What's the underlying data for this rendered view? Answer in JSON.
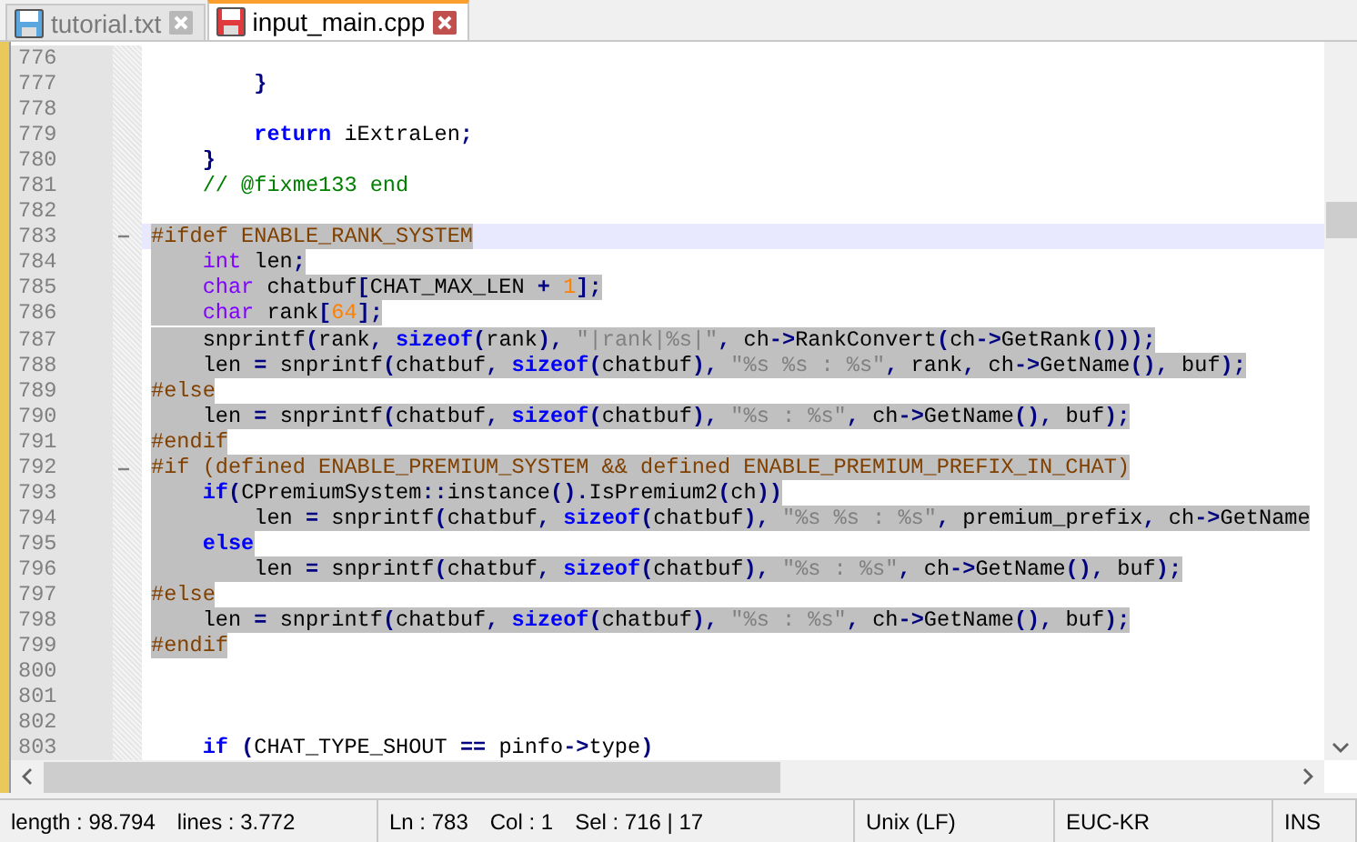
{
  "tabs": [
    {
      "label": "tutorial.txt",
      "selected": false
    },
    {
      "label": "input_main.cpp",
      "selected": true
    }
  ],
  "lines": [
    {
      "number": "776",
      "selected": false,
      "current": false,
      "foldable": false
    },
    {
      "number": "777",
      "selected": false,
      "current": false,
      "foldable": false,
      "tokens": [
        {
          "kind": "op",
          "text": "        }"
        }
      ]
    },
    {
      "number": "778",
      "selected": false,
      "current": false,
      "foldable": false
    },
    {
      "number": "779",
      "selected": false,
      "current": false,
      "foldable": false,
      "tokens": [
        {
          "kind": "keyword",
          "text": "        return"
        },
        {
          "kind": "plain",
          "text": " iExtraLen"
        },
        {
          "kind": "op",
          "text": ";"
        }
      ]
    },
    {
      "number": "780",
      "selected": false,
      "current": false,
      "foldable": false,
      "tokens": [
        {
          "kind": "op",
          "text": "    }"
        }
      ]
    },
    {
      "number": "781",
      "selected": false,
      "current": false,
      "foldable": false,
      "tokens": [
        {
          "kind": "comment",
          "text": "    // @fixme133 end"
        }
      ]
    },
    {
      "number": "782",
      "selected": false,
      "current": false,
      "foldable": false
    },
    {
      "number": "783",
      "selected": true,
      "current": true,
      "foldable": true,
      "tokens": [
        {
          "kind": "preprocessor",
          "text": "#ifdef ENABLE_RANK_SYSTEM"
        }
      ]
    },
    {
      "number": "784",
      "selected": true,
      "current": false,
      "foldable": false,
      "tokens": [
        {
          "kind": "type",
          "text": "    int"
        },
        {
          "kind": "plain",
          "text": " len"
        },
        {
          "kind": "op",
          "text": ";"
        }
      ]
    },
    {
      "number": "785",
      "selected": true,
      "current": false,
      "foldable": false,
      "tokens": [
        {
          "kind": "type",
          "text": "    char"
        },
        {
          "kind": "plain",
          "text": " chatbuf"
        },
        {
          "kind": "op",
          "text": "["
        },
        {
          "kind": "plain",
          "text": "CHAT_MAX_LEN "
        },
        {
          "kind": "op",
          "text": "+ "
        },
        {
          "kind": "number",
          "text": "1"
        },
        {
          "kind": "op",
          "text": "];"
        }
      ]
    },
    {
      "number": "786",
      "selected": true,
      "current": false,
      "foldable": false,
      "tokens": [
        {
          "kind": "type",
          "text": "    char"
        },
        {
          "kind": "plain",
          "text": " rank"
        },
        {
          "kind": "op",
          "text": "["
        },
        {
          "kind": "number",
          "text": "64"
        },
        {
          "kind": "op",
          "text": "];"
        }
      ]
    },
    {
      "number": "787",
      "selected": true,
      "current": false,
      "foldable": false,
      "tokens": [
        {
          "kind": "plain",
          "text": "    snprintf"
        },
        {
          "kind": "op",
          "text": "("
        },
        {
          "kind": "plain",
          "text": "rank"
        },
        {
          "kind": "op",
          "text": ", "
        },
        {
          "kind": "keyword",
          "text": "sizeof"
        },
        {
          "kind": "op",
          "text": "("
        },
        {
          "kind": "plain",
          "text": "rank"
        },
        {
          "kind": "op",
          "text": "), "
        },
        {
          "kind": "string",
          "text": "\"|rank|%s|\""
        },
        {
          "kind": "op",
          "text": ", "
        },
        {
          "kind": "plain",
          "text": "ch"
        },
        {
          "kind": "op",
          "text": "->"
        },
        {
          "kind": "plain",
          "text": "RankConvert"
        },
        {
          "kind": "op",
          "text": "("
        },
        {
          "kind": "plain",
          "text": "ch"
        },
        {
          "kind": "op",
          "text": "->"
        },
        {
          "kind": "plain",
          "text": "GetRank"
        },
        {
          "kind": "op",
          "text": "()));"
        }
      ]
    },
    {
      "number": "788",
      "selected": true,
      "current": false,
      "foldable": false,
      "tokens": [
        {
          "kind": "plain",
          "text": "    len "
        },
        {
          "kind": "op",
          "text": "="
        },
        {
          "kind": "plain",
          "text": " snprintf"
        },
        {
          "kind": "op",
          "text": "("
        },
        {
          "kind": "plain",
          "text": "chatbuf"
        },
        {
          "kind": "op",
          "text": ", "
        },
        {
          "kind": "keyword",
          "text": "sizeof"
        },
        {
          "kind": "op",
          "text": "("
        },
        {
          "kind": "plain",
          "text": "chatbuf"
        },
        {
          "kind": "op",
          "text": "), "
        },
        {
          "kind": "string",
          "text": "\"%s %s : %s\""
        },
        {
          "kind": "op",
          "text": ", "
        },
        {
          "kind": "plain",
          "text": "rank"
        },
        {
          "kind": "op",
          "text": ", "
        },
        {
          "kind": "plain",
          "text": "ch"
        },
        {
          "kind": "op",
          "text": "->"
        },
        {
          "kind": "plain",
          "text": "GetName"
        },
        {
          "kind": "op",
          "text": "(), "
        },
        {
          "kind": "plain",
          "text": "buf"
        },
        {
          "kind": "op",
          "text": ");"
        }
      ]
    },
    {
      "number": "789",
      "selected": true,
      "current": false,
      "foldable": false,
      "tokens": [
        {
          "kind": "preprocessor",
          "text": "#else"
        }
      ]
    },
    {
      "number": "790",
      "selected": true,
      "current": false,
      "foldable": false,
      "tokens": [
        {
          "kind": "plain",
          "text": "    len "
        },
        {
          "kind": "op",
          "text": "="
        },
        {
          "kind": "plain",
          "text": " snprintf"
        },
        {
          "kind": "op",
          "text": "("
        },
        {
          "kind": "plain",
          "text": "chatbuf"
        },
        {
          "kind": "op",
          "text": ", "
        },
        {
          "kind": "keyword",
          "text": "sizeof"
        },
        {
          "kind": "op",
          "text": "("
        },
        {
          "kind": "plain",
          "text": "chatbuf"
        },
        {
          "kind": "op",
          "text": "), "
        },
        {
          "kind": "string",
          "text": "\"%s : %s\""
        },
        {
          "kind": "op",
          "text": ", "
        },
        {
          "kind": "plain",
          "text": "ch"
        },
        {
          "kind": "op",
          "text": "->"
        },
        {
          "kind": "plain",
          "text": "GetName"
        },
        {
          "kind": "op",
          "text": "(), "
        },
        {
          "kind": "plain",
          "text": "buf"
        },
        {
          "kind": "op",
          "text": ");"
        }
      ]
    },
    {
      "number": "791",
      "selected": true,
      "current": false,
      "foldable": false,
      "tokens": [
        {
          "kind": "preprocessor",
          "text": "#endif"
        }
      ]
    },
    {
      "number": "792",
      "selected": true,
      "current": false,
      "foldable": true,
      "tokens": [
        {
          "kind": "preprocessor",
          "text": "#if (defined ENABLE_PREMIUM_SYSTEM && defined ENABLE_PREMIUM_PREFIX_IN_CHAT)"
        }
      ]
    },
    {
      "number": "793",
      "selected": true,
      "current": false,
      "foldable": false,
      "tokens": [
        {
          "kind": "keyword",
          "text": "    if"
        },
        {
          "kind": "op",
          "text": "("
        },
        {
          "kind": "plain",
          "text": "CPremiumSystem"
        },
        {
          "kind": "op",
          "text": "::"
        },
        {
          "kind": "plain",
          "text": "instance"
        },
        {
          "kind": "op",
          "text": "()."
        },
        {
          "kind": "plain",
          "text": "IsPremium2"
        },
        {
          "kind": "op",
          "text": "("
        },
        {
          "kind": "plain",
          "text": "ch"
        },
        {
          "kind": "op",
          "text": "))"
        }
      ]
    },
    {
      "number": "794",
      "selected": true,
      "current": false,
      "foldable": false,
      "tokens": [
        {
          "kind": "plain",
          "text": "        len "
        },
        {
          "kind": "op",
          "text": "="
        },
        {
          "kind": "plain",
          "text": " snprintf"
        },
        {
          "kind": "op",
          "text": "("
        },
        {
          "kind": "plain",
          "text": "chatbuf"
        },
        {
          "kind": "op",
          "text": ", "
        },
        {
          "kind": "keyword",
          "text": "sizeof"
        },
        {
          "kind": "op",
          "text": "("
        },
        {
          "kind": "plain",
          "text": "chatbuf"
        },
        {
          "kind": "op",
          "text": "), "
        },
        {
          "kind": "string",
          "text": "\"%s %s : %s\""
        },
        {
          "kind": "op",
          "text": ", "
        },
        {
          "kind": "plain",
          "text": "premium_prefix"
        },
        {
          "kind": "op",
          "text": ", "
        },
        {
          "kind": "plain",
          "text": "ch"
        },
        {
          "kind": "op",
          "text": "->"
        },
        {
          "kind": "plain",
          "text": "GetName"
        }
      ]
    },
    {
      "number": "795",
      "selected": true,
      "current": false,
      "foldable": false,
      "tokens": [
        {
          "kind": "keyword",
          "text": "    else"
        }
      ]
    },
    {
      "number": "796",
      "selected": true,
      "current": false,
      "foldable": false,
      "tokens": [
        {
          "kind": "plain",
          "text": "        len "
        },
        {
          "kind": "op",
          "text": "="
        },
        {
          "kind": "plain",
          "text": " snprintf"
        },
        {
          "kind": "op",
          "text": "("
        },
        {
          "kind": "plain",
          "text": "chatbuf"
        },
        {
          "kind": "op",
          "text": ", "
        },
        {
          "kind": "keyword",
          "text": "sizeof"
        },
        {
          "kind": "op",
          "text": "("
        },
        {
          "kind": "plain",
          "text": "chatbuf"
        },
        {
          "kind": "op",
          "text": "), "
        },
        {
          "kind": "string",
          "text": "\"%s : %s\""
        },
        {
          "kind": "op",
          "text": ", "
        },
        {
          "kind": "plain",
          "text": "ch"
        },
        {
          "kind": "op",
          "text": "->"
        },
        {
          "kind": "plain",
          "text": "GetName"
        },
        {
          "kind": "op",
          "text": "(), "
        },
        {
          "kind": "plain",
          "text": "buf"
        },
        {
          "kind": "op",
          "text": ");"
        }
      ]
    },
    {
      "number": "797",
      "selected": true,
      "current": false,
      "foldable": false,
      "tokens": [
        {
          "kind": "preprocessor",
          "text": "#else"
        }
      ]
    },
    {
      "number": "798",
      "selected": true,
      "current": false,
      "foldable": false,
      "tokens": [
        {
          "kind": "plain",
          "text": "    len "
        },
        {
          "kind": "op",
          "text": "="
        },
        {
          "kind": "plain",
          "text": " snprintf"
        },
        {
          "kind": "op",
          "text": "("
        },
        {
          "kind": "plain",
          "text": "chatbuf"
        },
        {
          "kind": "op",
          "text": ", "
        },
        {
          "kind": "keyword",
          "text": "sizeof"
        },
        {
          "kind": "op",
          "text": "("
        },
        {
          "kind": "plain",
          "text": "chatbuf"
        },
        {
          "kind": "op",
          "text": "), "
        },
        {
          "kind": "string",
          "text": "\"%s : %s\""
        },
        {
          "kind": "op",
          "text": ", "
        },
        {
          "kind": "plain",
          "text": "ch"
        },
        {
          "kind": "op",
          "text": "->"
        },
        {
          "kind": "plain",
          "text": "GetName"
        },
        {
          "kind": "op",
          "text": "(), "
        },
        {
          "kind": "plain",
          "text": "buf"
        },
        {
          "kind": "op",
          "text": ");"
        }
      ]
    },
    {
      "number": "799",
      "selected": true,
      "current": false,
      "foldable": false,
      "tokens": [
        {
          "kind": "preprocessor",
          "text": "#endif"
        }
      ]
    },
    {
      "number": "800",
      "selected": false,
      "current": false,
      "foldable": false
    },
    {
      "number": "801",
      "selected": false,
      "current": false,
      "foldable": false
    },
    {
      "number": "802",
      "selected": false,
      "current": false,
      "foldable": false
    },
    {
      "number": "803",
      "selected": false,
      "current": false,
      "foldable": false,
      "tokens": [
        {
          "kind": "keyword",
          "text": "    if "
        },
        {
          "kind": "op",
          "text": "("
        },
        {
          "kind": "plain",
          "text": "CHAT_TYPE_SHOUT "
        },
        {
          "kind": "op",
          "text": "=="
        },
        {
          "kind": "plain",
          "text": " pinfo"
        },
        {
          "kind": "op",
          "text": "->"
        },
        {
          "kind": "plain",
          "text": "type"
        },
        {
          "kind": "op",
          "text": ")"
        }
      ]
    }
  ],
  "status_bar": {
    "length": "length : 98.794",
    "lines": "lines : 3.772",
    "ln": "Ln : 783",
    "col": "Col : 1",
    "sel": "Sel : 716 | 17",
    "eol": "Unix (LF)",
    "encoding": "EUC-KR",
    "mode": "INS"
  }
}
